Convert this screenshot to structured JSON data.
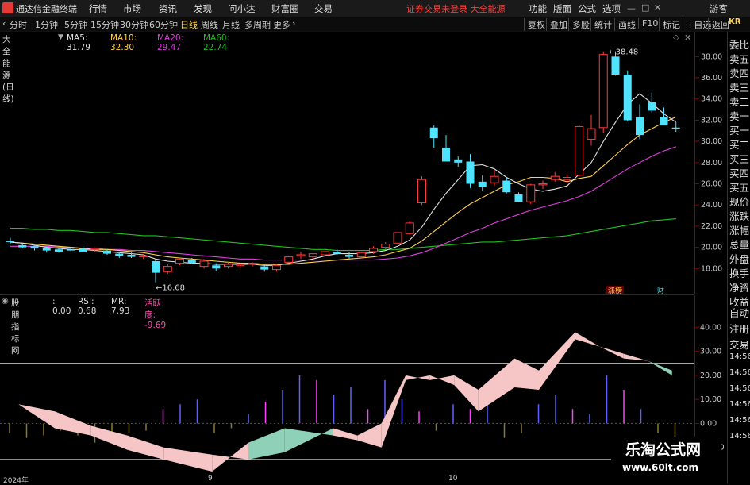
{
  "app": {
    "title": "通达信金融终端",
    "menu": [
      "行情",
      "市场",
      "资讯",
      "发现",
      "问小达",
      "财富圈",
      "交易"
    ],
    "notice": "证券交易未登录  大全能源",
    "right_menu": [
      "功能",
      "版面",
      "公式",
      "选项"
    ],
    "guest": "游客"
  },
  "toolbar": {
    "periods": [
      "分时",
      "1分钟",
      "5分钟",
      "15分钟",
      "30分钟",
      "60分钟",
      "日线",
      "周线",
      "月线",
      "多周期",
      "更多"
    ],
    "active_period": "日线",
    "tools": [
      "复权",
      "叠加",
      "多股",
      "统计",
      "画线",
      "F10",
      "标记",
      "+自选",
      "返回"
    ]
  },
  "main_info": {
    "name": "大全能源(日线)",
    "ma5": "MA5: 31.79",
    "ma10": "MA10: 32.30",
    "ma20": "MA20: 29.47",
    "ma60": "MA60: 22.74",
    "colors": {
      "ma5": "#e0e0e0",
      "ma10": "#ffd24a",
      "ma20": "#e040e0",
      "ma60": "#20c020",
      "up": "#ff3b3b",
      "down": "#4fe3ff"
    }
  },
  "indicator_info": {
    "name": "股朋指标网",
    "value": ": 0.00",
    "rsi": "RSI: 0.68",
    "mr": "MR: 7.93",
    "activity": "活跃度: -9.69"
  },
  "labels": {
    "high": "38.48",
    "low": "16.68",
    "badge1": "涨榜",
    "badge2": "财"
  },
  "sidebar": [
    "委比",
    "卖五",
    "卖四",
    "卖三",
    "卖二",
    "卖一",
    "买一",
    "买二",
    "买三",
    "买四",
    "买五",
    "现价",
    "涨跌",
    "涨幅",
    "总量",
    "外盘",
    "换手",
    "净资",
    "收益",
    "自动",
    "注册",
    "交易",
    "14:56",
    "14:56",
    "14:56",
    "14:56",
    "14:56",
    "14:56"
  ],
  "sidebar_top": "KR",
  "watermark": {
    "line1": "乐淘公式网",
    "line2": "www.60lt.com"
  },
  "dates": [
    "2024年",
    "9",
    "10"
  ],
  "chart_data": [
    {
      "type": "candlestick",
      "name": "大全能源(日线)",
      "ylim": [
        16.0,
        39.0
      ],
      "yticks": [
        18.0,
        20.0,
        22.0,
        24.0,
        26.0,
        28.0,
        30.0,
        32.0,
        34.0,
        36.0,
        38.0
      ],
      "candles": [
        [
          20.6,
          20.9,
          20.3,
          20.5
        ],
        [
          20.2,
          20.3,
          19.9,
          20.0
        ],
        [
          20.1,
          20.2,
          19.7,
          19.9
        ],
        [
          19.9,
          20.1,
          19.5,
          19.7
        ],
        [
          19.8,
          19.9,
          19.5,
          19.6
        ],
        [
          19.8,
          20.0,
          19.6,
          19.7
        ],
        [
          19.9,
          20.1,
          19.5,
          19.6
        ],
        [
          19.8,
          20.0,
          19.6,
          19.9
        ],
        [
          19.7,
          19.8,
          19.3,
          19.4
        ],
        [
          19.4,
          19.6,
          19.0,
          19.2
        ],
        [
          19.3,
          19.5,
          19.0,
          19.1
        ],
        [
          19.1,
          19.4,
          18.9,
          19.2
        ],
        [
          18.7,
          18.8,
          16.7,
          17.6
        ],
        [
          17.7,
          18.4,
          17.5,
          18.2
        ],
        [
          18.5,
          19.0,
          18.3,
          18.9
        ],
        [
          18.8,
          19.0,
          18.4,
          18.5
        ],
        [
          18.2,
          18.9,
          18.0,
          18.7
        ],
        [
          18.3,
          18.5,
          17.8,
          18.0
        ],
        [
          18.2,
          18.6,
          18.0,
          18.4
        ],
        [
          18.3,
          18.5,
          18.1,
          18.4
        ],
        [
          18.4,
          18.6,
          18.2,
          18.5
        ],
        [
          18.2,
          18.4,
          17.7,
          17.9
        ],
        [
          17.9,
          18.4,
          17.7,
          18.3
        ],
        [
          18.6,
          19.2,
          18.5,
          19.1
        ],
        [
          19.2,
          19.6,
          18.9,
          19.3
        ],
        [
          19.1,
          19.4,
          18.9,
          19.4
        ],
        [
          19.3,
          19.7,
          19.2,
          19.6
        ],
        [
          19.6,
          19.8,
          19.3,
          19.4
        ],
        [
          19.3,
          19.6,
          18.9,
          19.1
        ],
        [
          19.1,
          19.6,
          19.0,
          19.5
        ],
        [
          19.6,
          20.1,
          19.4,
          19.9
        ],
        [
          20.0,
          20.5,
          19.8,
          20.3
        ],
        [
          20.4,
          21.4,
          20.3,
          21.4
        ],
        [
          21.3,
          22.5,
          21.2,
          22.3
        ],
        [
          24.2,
          26.7,
          24.0,
          26.4
        ],
        [
          31.3,
          31.5,
          29.4,
          30.3
        ],
        [
          29.4,
          30.6,
          28.1,
          28.1
        ],
        [
          28.3,
          28.6,
          27.6,
          28.0
        ],
        [
          28.1,
          28.8,
          25.6,
          26.0
        ],
        [
          26.2,
          26.8,
          25.3,
          25.7
        ],
        [
          26.1,
          27.3,
          25.8,
          26.7
        ],
        [
          26.3,
          26.6,
          25.1,
          25.2
        ],
        [
          25.0,
          25.2,
          24.3,
          24.3
        ],
        [
          24.3,
          26.0,
          24.1,
          25.9
        ],
        [
          25.9,
          26.3,
          25.5,
          26.0
        ],
        [
          26.4,
          27.1,
          26.2,
          26.7
        ],
        [
          26.4,
          26.9,
          26.2,
          26.6
        ],
        [
          26.8,
          31.6,
          26.6,
          31.4
        ],
        [
          30.2,
          32.5,
          29.6,
          31.2
        ],
        [
          31.3,
          38.5,
          30.8,
          38.2
        ],
        [
          38.0,
          38.5,
          36.2,
          36.3
        ],
        [
          36.3,
          36.7,
          31.9,
          32.0
        ],
        [
          32.3,
          33.5,
          30.2,
          30.6
        ],
        [
          33.7,
          34.6,
          32.7,
          32.9
        ],
        [
          32.3,
          33.2,
          31.6,
          31.5
        ],
        [
          31.3,
          31.8,
          30.9,
          31.2
        ]
      ],
      "ma5": [
        20.5,
        20.4,
        20.2,
        20.0,
        19.9,
        19.8,
        19.8,
        19.7,
        19.6,
        19.5,
        19.4,
        19.3,
        18.9,
        18.7,
        18.6,
        18.5,
        18.5,
        18.4,
        18.4,
        18.4,
        18.4,
        18.3,
        18.3,
        18.5,
        18.7,
        18.9,
        19.2,
        19.4,
        19.4,
        19.4,
        19.5,
        19.7,
        20.1,
        20.7,
        21.9,
        23.6,
        25.1,
        26.4,
        27.7,
        27.8,
        27.4,
        26.6,
        26.0,
        25.5,
        25.3,
        25.5,
        25.8,
        26.9,
        28.0,
        30.0,
        31.8,
        33.5,
        34.5,
        33.6,
        32.6,
        31.8
      ],
      "ma10": [
        20.5,
        20.4,
        20.3,
        20.2,
        20.1,
        20.0,
        19.9,
        19.8,
        19.8,
        19.7,
        19.6,
        19.5,
        19.3,
        19.1,
        19.0,
        18.9,
        18.8,
        18.7,
        18.6,
        18.5,
        18.5,
        18.4,
        18.4,
        18.4,
        18.5,
        18.6,
        18.7,
        18.8,
        18.9,
        19.0,
        19.1,
        19.3,
        19.6,
        19.9,
        20.6,
        21.5,
        22.4,
        23.3,
        24.1,
        24.7,
        25.3,
        25.9,
        26.2,
        26.6,
        26.6,
        26.5,
        26.2,
        26.5,
        26.7,
        27.7,
        28.7,
        29.7,
        30.6,
        31.2,
        31.8,
        32.3
      ],
      "ma20": [
        20.1,
        20.1,
        20.1,
        20.1,
        20.0,
        20.0,
        19.9,
        19.9,
        19.8,
        19.8,
        19.7,
        19.7,
        19.6,
        19.5,
        19.4,
        19.3,
        19.2,
        19.1,
        19.0,
        18.9,
        18.9,
        18.8,
        18.8,
        18.8,
        18.8,
        18.8,
        18.8,
        18.8,
        18.8,
        18.8,
        18.8,
        18.9,
        19.0,
        19.2,
        19.5,
        19.9,
        20.4,
        20.9,
        21.4,
        21.8,
        22.3,
        22.7,
        23.1,
        23.5,
        23.8,
        24.1,
        24.4,
        24.8,
        25.3,
        26.0,
        26.7,
        27.4,
        28.0,
        28.6,
        29.1,
        29.5
      ],
      "ma60": [
        21.8,
        21.8,
        21.7,
        21.7,
        21.6,
        21.6,
        21.5,
        21.4,
        21.4,
        21.3,
        21.2,
        21.1,
        21.1,
        21.0,
        20.9,
        20.8,
        20.7,
        20.6,
        20.5,
        20.4,
        20.3,
        20.2,
        20.1,
        20.0,
        19.9,
        19.8,
        19.8,
        19.7,
        19.7,
        19.7,
        19.7,
        19.8,
        19.8,
        19.9,
        20.0,
        20.1,
        20.2,
        20.3,
        20.4,
        20.5,
        20.5,
        20.6,
        20.7,
        20.8,
        20.9,
        21.0,
        21.1,
        21.3,
        21.5,
        21.7,
        21.9,
        22.1,
        22.3,
        22.5,
        22.6,
        22.7
      ]
    },
    {
      "type": "area",
      "name": "股朋指标网",
      "ylim": [
        -20,
        50
      ],
      "yticks": [
        40.0,
        30.0,
        20.0,
        10.0,
        0.0,
        -10.0
      ],
      "hlines": [
        25,
        -15
      ],
      "x": [
        1,
        4,
        7,
        10,
        13,
        17,
        20,
        23,
        27,
        29,
        31,
        33,
        35,
        37,
        39,
        42,
        44,
        47,
        49,
        51,
        53,
        55
      ],
      "rsi": [
        8,
        -2,
        -5,
        -11,
        -15,
        -20,
        -8,
        -2,
        -5,
        -7,
        -10,
        18,
        20,
        16,
        5,
        15,
        14,
        35,
        32,
        27,
        26,
        22
      ],
      "mr": [
        8,
        5,
        -1,
        -5,
        -10,
        -13,
        -15,
        -12,
        -2,
        -5,
        0,
        20,
        18,
        20,
        14,
        27,
        22,
        38,
        32,
        29,
        26,
        20
      ],
      "bars": [
        -4,
        -6,
        -5,
        -3,
        -5,
        -8,
        -6,
        -4,
        -3,
        6,
        8,
        10,
        -4,
        -2,
        4,
        9,
        14,
        20,
        18,
        12,
        15,
        6,
        18,
        10,
        5,
        -3,
        8,
        6,
        10,
        -6,
        -4,
        8,
        12,
        6,
        4,
        20,
        14,
        6,
        -4,
        -6
      ]
    }
  ]
}
